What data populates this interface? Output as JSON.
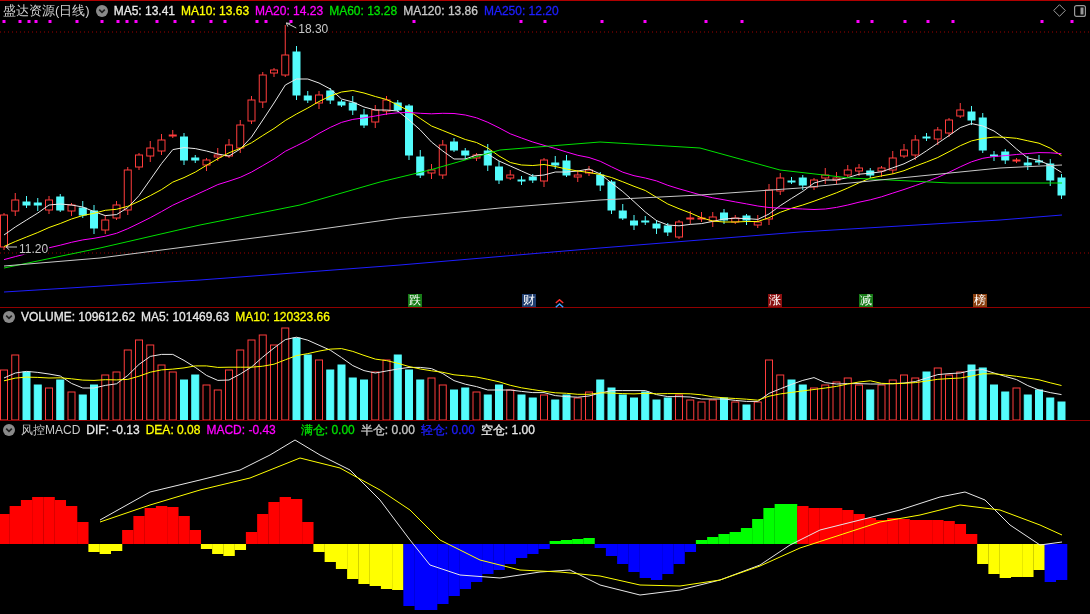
{
  "price_panel": {
    "title": "盛达资源(日线)",
    "indicators": [
      {
        "label": "MA5: 13.41",
        "color": "#e8e8e8"
      },
      {
        "label": "MA10: 13.63",
        "color": "#ffff00"
      },
      {
        "label": "MA20: 14.23",
        "color": "#ff00ff"
      },
      {
        "label": "MA60: 13.28",
        "color": "#00e000"
      },
      {
        "label": "MA120: 13.86",
        "color": "#c8c8c8"
      },
      {
        "label": "MA250: 12.20",
        "color": "#1e1eff"
      }
    ],
    "high_label": "18.30",
    "low_label": "11.20",
    "event_tags": [
      {
        "text": "跌",
        "color": "#177b17"
      },
      {
        "text": "财",
        "color": "#1f3d6e"
      },
      {
        "text": "涨",
        "color": "#8b0f0f"
      },
      {
        "text": "减",
        "color": "#177b17"
      },
      {
        "text": "榜",
        "color": "#8a4010"
      }
    ]
  },
  "volume_panel": {
    "indicators": [
      {
        "label": "VOLUME: 109612.62",
        "color": "#e8e8e8"
      },
      {
        "label": "MA5: 101469.63",
        "color": "#e8e8e8"
      },
      {
        "label": "MA10: 120323.66",
        "color": "#ffff00"
      }
    ]
  },
  "macd_panel": {
    "title": "风控MACD",
    "indicators": [
      {
        "label": "DIF: -0.13",
        "color": "#e8e8e8"
      },
      {
        "label": "DEA: 0.08",
        "color": "#ffff00"
      },
      {
        "label": "MACD: -0.43",
        "color": "#ff00ff"
      }
    ],
    "positions": [
      {
        "label": "满仓: 0.00",
        "color": "#00e000"
      },
      {
        "label": "半仓: 0.00",
        "color": "#c8c8c8"
      },
      {
        "label": "轻仓: 0.00",
        "color": "#1e1eff"
      },
      {
        "label": "空仓: 1.00",
        "color": "#e8e8e8"
      }
    ]
  }
}
